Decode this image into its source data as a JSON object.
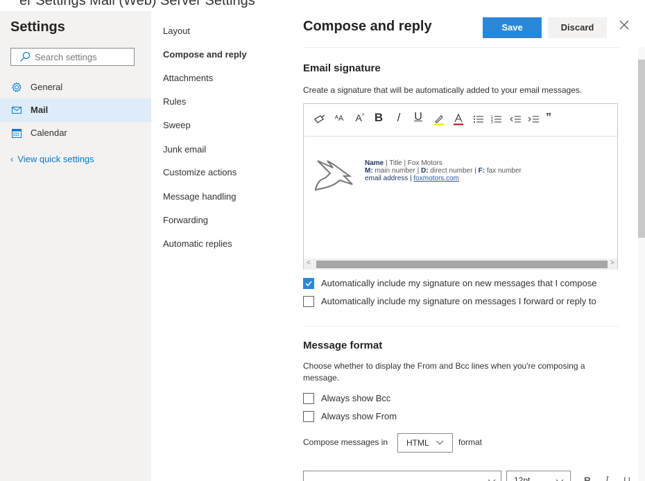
{
  "top_strip_text": "er Settings Mail (Web) Server Settings",
  "left": {
    "title": "Settings",
    "search_placeholder": "Search settings",
    "nav": [
      {
        "label": "General",
        "icon": "gear-icon",
        "active": false
      },
      {
        "label": "Mail",
        "icon": "mail-icon",
        "active": true
      },
      {
        "label": "Calendar",
        "icon": "calendar-icon",
        "active": false
      }
    ],
    "view_quick": "View quick settings"
  },
  "middle": {
    "items": [
      {
        "label": "Layout",
        "active": false
      },
      {
        "label": "Compose and reply",
        "active": true
      },
      {
        "label": "Attachments",
        "active": false
      },
      {
        "label": "Rules",
        "active": false
      },
      {
        "label": "Sweep",
        "active": false
      },
      {
        "label": "Junk email",
        "active": false
      },
      {
        "label": "Customize actions",
        "active": false
      },
      {
        "label": "Message handling",
        "active": false
      },
      {
        "label": "Forwarding",
        "active": false
      },
      {
        "label": "Automatic replies",
        "active": false
      }
    ]
  },
  "right": {
    "title": "Compose and reply",
    "save_label": "Save",
    "discard_label": "Discard",
    "signature": {
      "title": "Email signature",
      "description": "Create a signature that will be automatically added to your email messages.",
      "block": {
        "name": "Name",
        "title_line": " | Title | Fox Motors",
        "m_label": "M:",
        "m_value": " main number | ",
        "d_label": "D:",
        "d_value": " direct number | ",
        "f_label": "F:",
        "f_value": " fax number",
        "email": "email address | ",
        "site": "foxmotors.com"
      },
      "options": [
        {
          "label": "Automatically include my signature on new messages that I compose",
          "checked": true
        },
        {
          "label": "Automatically include my signature on messages I forward or reply to",
          "checked": false
        }
      ]
    },
    "message_format": {
      "title": "Message format",
      "description": "Choose whether to display the From and Bcc lines when you're composing a message.",
      "options": [
        {
          "label": "Always show Bcc",
          "checked": false
        },
        {
          "label": "Always show From",
          "checked": false
        }
      ],
      "compose_pre": "Compose messages in",
      "compose_value": "HTML",
      "compose_post": "format",
      "font_size": "12pt"
    }
  },
  "colors": {
    "accent": "#2b88d8",
    "nav_active_bg": "#deecf9",
    "link": "#0078d4"
  }
}
